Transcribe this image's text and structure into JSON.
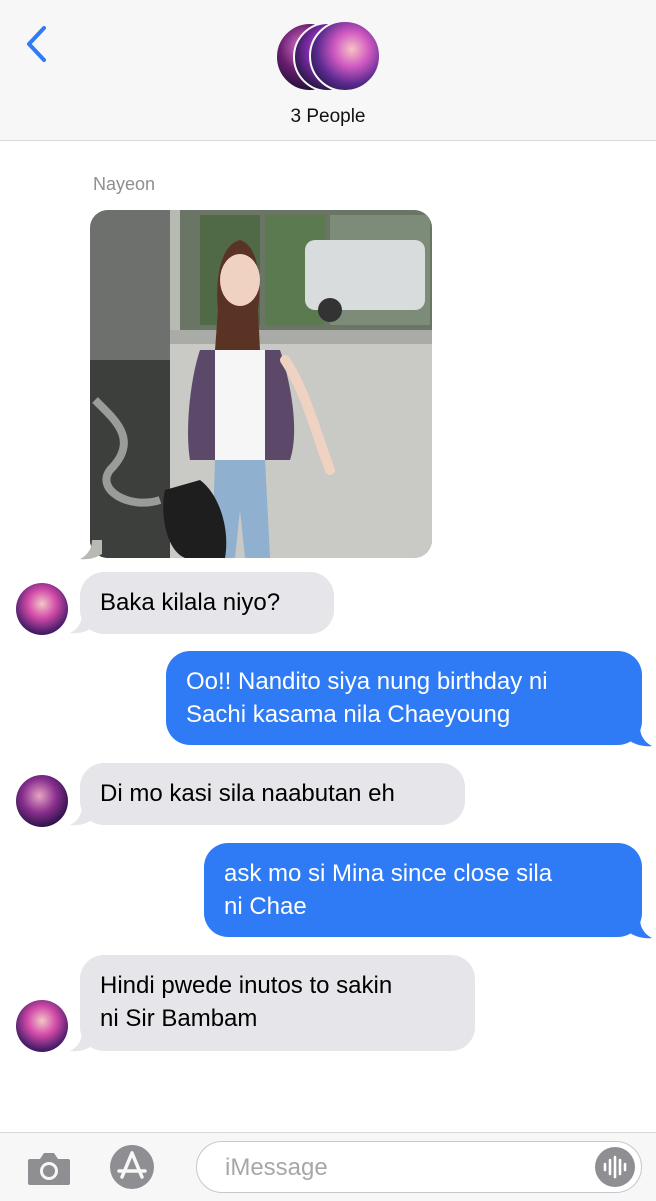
{
  "header": {
    "title": "3 People",
    "back_icon": "chevron-left-icon"
  },
  "conversation": {
    "sender_name": "Nayeon",
    "messages": [
      {
        "direction": "incoming",
        "text": "Baka kilala niyo?"
      },
      {
        "direction": "outgoing",
        "line1": "Oo!! Nandito siya nung birthday ni",
        "line2": "Sachi kasama nila Chaeyoung"
      },
      {
        "direction": "incoming",
        "text": "Di mo kasi sila naabutan eh"
      },
      {
        "direction": "outgoing",
        "line1": "ask mo si Mina since close sila",
        "line2": "ni Chae"
      },
      {
        "direction": "incoming",
        "line1": "Hindi pwede inutos to sakin",
        "line2": "ni Sir Bambam"
      }
    ]
  },
  "composer": {
    "placeholder": "iMessage",
    "camera_icon": "camera-icon",
    "appstore_icon": "app-store-icon",
    "audio_icon": "audio-waveform-icon"
  },
  "colors": {
    "outgoing_bubble": "#2f7bf6",
    "incoming_bubble": "#e5e5ea",
    "ios_blue": "#2f7bf6"
  }
}
